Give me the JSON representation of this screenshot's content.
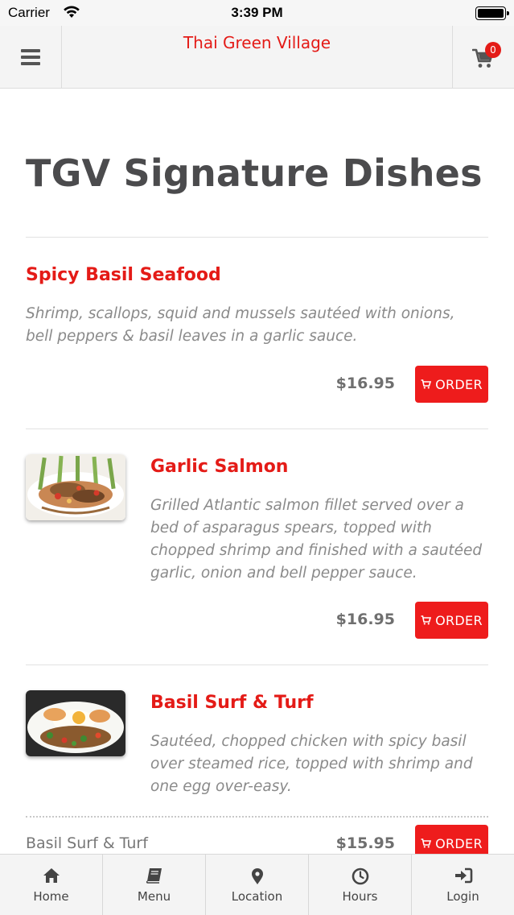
{
  "status_bar": {
    "carrier": "Carrier",
    "time": "3:39 PM"
  },
  "header": {
    "title": "Thai Green Village",
    "cart_count": "0"
  },
  "section": {
    "title": "TGV Signature Dishes"
  },
  "dishes": [
    {
      "name": "Spicy Basil Seafood",
      "description": "Shrimp, scallops, squid and mussels sautéed with onions, bell peppers & basil leaves in a garlic sauce.",
      "price": "$16.95",
      "order_label": "ORDER",
      "has_photo": false
    },
    {
      "name": "Garlic Salmon",
      "description": "Grilled Atlantic salmon fillet served over a bed of asparagus spears, topped with chopped shrimp and finished with a sautéed garlic, onion and bell pepper sauce.",
      "price": "$16.95",
      "order_label": "ORDER",
      "has_photo": true
    },
    {
      "name": "Basil Surf & Turf",
      "description": "Sautéed, chopped chicken with spicy basil over steamed rice, topped with shrimp and one egg over-easy.",
      "has_photo": true,
      "options": [
        {
          "name": "Basil Surf & Turf",
          "price": "$15.95",
          "order_label": "ORDER"
        }
      ]
    }
  ],
  "tabs": [
    {
      "label": "Home",
      "icon": "home-icon"
    },
    {
      "label": "Menu",
      "icon": "book-icon"
    },
    {
      "label": "Location",
      "icon": "map-pin-icon"
    },
    {
      "label": "Hours",
      "icon": "clock-icon"
    },
    {
      "label": "Login",
      "icon": "login-icon"
    }
  ],
  "colors": {
    "accent": "#e41b17",
    "button": "#ee1c1c",
    "title": "#4b4b4d"
  }
}
